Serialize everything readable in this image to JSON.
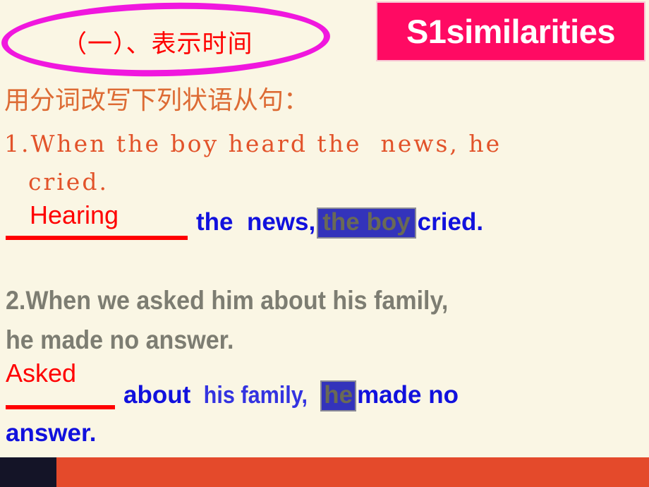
{
  "slide": {
    "background_color": "#FAF6E4"
  },
  "title_badge": {
    "text": "S1similarities",
    "background_color": "#FF0A63",
    "text_color": "#FFFFFF",
    "border_color": "#F7C6D4"
  },
  "ellipse": {
    "stroke_color": "#F017DE",
    "heading_text": "（一）、表示时间",
    "heading_color": "#FF0000"
  },
  "instruction": {
    "text": "用分词改写下列状语从句：",
    "color": "#DD6B34"
  },
  "question1": {
    "line1": "1.When the boy heard the  news, he",
    "line2": "cried.",
    "color": "#E2532A",
    "answer": {
      "fill_word": "Hearing",
      "fill_color": "#FF0000",
      "rule_color": "#FF0000",
      "before_highlight": "the  news,",
      "highlight": "the boy",
      "after_highlight": "cried.",
      "text_color": "#1111DD",
      "highlight_bg": "#3333BB",
      "highlight_text_color": "#6A6A55",
      "highlight_border_color": "#8A8A96"
    }
  },
  "question2": {
    "line1": "2.When we asked him about his family,",
    "line2": "he made no answer.",
    "color": "#7D7D72",
    "answer": {
      "fill_word": "Asked",
      "fill_color": "#FF0000",
      "rule_color": "#FF0000",
      "segment_strong": "about ",
      "segment_light": "his family, ",
      "highlight": "he",
      "after_highlight": "made no",
      "tail": "answer.",
      "text_color": "#1111DD",
      "light_text_color": "#3333E0",
      "highlight_bg": "#3333BB",
      "highlight_text_color": "#6A6A55",
      "highlight_border_color": "#8A8A96"
    }
  },
  "bottom_bar": {
    "dark_color": "#141427",
    "orange_color": "#E44A2B"
  }
}
